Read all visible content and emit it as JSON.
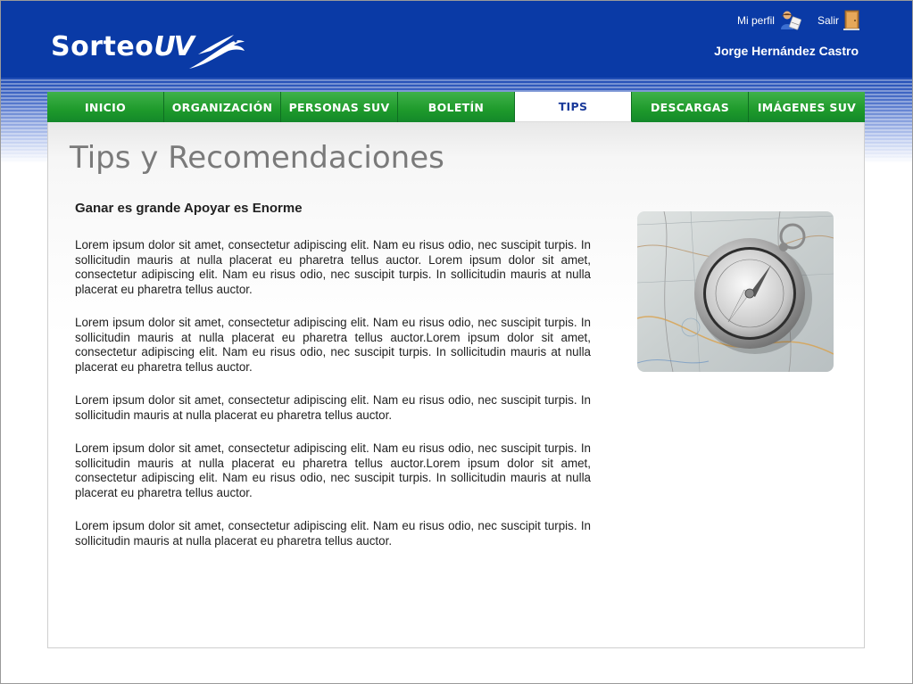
{
  "header": {
    "logo_text_main": "Sorteo",
    "logo_text_uv": "UV",
    "profile_label": "Mi perfil",
    "logout_label": "Salir",
    "user_name": "Jorge Hernández Castro"
  },
  "nav": {
    "items": [
      {
        "label": "INICIO"
      },
      {
        "label": "ORGANIZACIÓN"
      },
      {
        "label": "PERSONAS SUV"
      },
      {
        "label": "BOLETÍN"
      },
      {
        "label": "TIPS"
      },
      {
        "label": "DESCARGAS"
      },
      {
        "label": "IMÁGENES SUV"
      }
    ],
    "active_index": 4
  },
  "content": {
    "title": "Tips y Recomendaciones",
    "subtitle": "Ganar es grande Apoyar es Enorme",
    "paragraphs": [
      "Lorem ipsum dolor sit amet, consectetur adipiscing elit. Nam eu risus odio, nec suscipit turpis. In sollicitudin mauris at nulla placerat eu pharetra tellus auctor. Lorem ipsum dolor sit amet, consectetur adipiscing elit. Nam eu risus odio, nec suscipit turpis. In sollicitudin mauris at nulla placerat eu pharetra tellus auctor.",
      "Lorem ipsum dolor sit amet, consectetur adipiscing elit. Nam eu risus odio, nec suscipit turpis. In sollicitudin mauris at nulla placerat eu pharetra tellus auctor.Lorem ipsum dolor sit amet, consectetur adipiscing elit. Nam eu risus odio, nec suscipit turpis. In sollicitudin mauris at nulla placerat eu pharetra tellus auctor.",
      "Lorem ipsum dolor sit amet, consectetur adipiscing elit. Nam eu risus odio, nec suscipit turpis. In sollicitudin mauris at nulla placerat eu pharetra tellus auctor.",
      "Lorem ipsum dolor sit amet, consectetur adipiscing elit. Nam eu risus odio, nec suscipit turpis. In sollicitudin mauris at nulla placerat eu pharetra tellus auctor.Lorem ipsum dolor sit amet, consectetur adipiscing elit. Nam eu risus odio, nec suscipit turpis. In sollicitudin mauris at nulla placerat eu pharetra tellus auctor.",
      "Lorem ipsum dolor sit amet, consectetur adipiscing elit. Nam eu risus odio, nec suscipit turpis. In sollicitudin mauris at nulla placerat eu pharetra tellus auctor."
    ],
    "image_icon": "compass-on-map-image"
  },
  "colors": {
    "header_blue": "#0a3aa6",
    "nav_green": "#1e9a2b",
    "active_tab_text": "#1a3a9a",
    "title_gray": "#7a7a7a"
  }
}
